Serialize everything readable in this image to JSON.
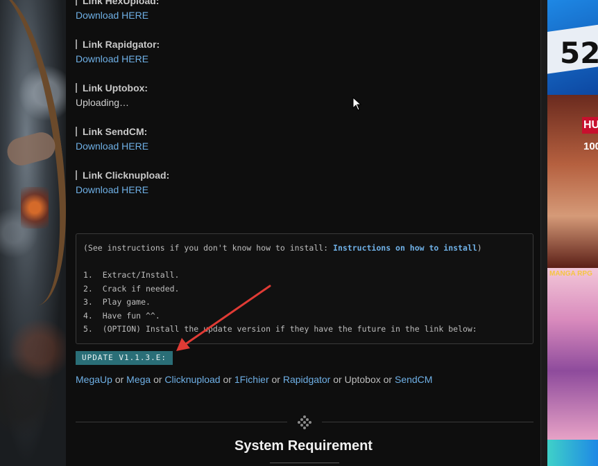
{
  "links": [
    {
      "label": "Link HexUpload:",
      "value": "Download HERE",
      "is_link": true
    },
    {
      "label": "Link Rapidgator:",
      "value": "Download HERE",
      "is_link": true
    },
    {
      "label": "Link Uptobox:",
      "value": "Uploading…",
      "is_link": false
    },
    {
      "label": "Link SendCM:",
      "value": "Download HERE",
      "is_link": true
    },
    {
      "label": "Link Clicknupload:",
      "value": "Download HERE",
      "is_link": true
    }
  ],
  "instructions": {
    "intro_prefix": "(See instructions if you don't know how to install: ",
    "intro_link": "Instructions on how to install",
    "intro_suffix": ")",
    "steps": [
      "1.  Extract/Install.",
      "2.  Crack if needed.",
      "3.  Play game.",
      "4.  Have fun ^^.",
      "5.  (OPTION) Install the update version if they have the future in the link below:"
    ]
  },
  "update_label": "UPDATE V1.1.3.E:",
  "mirrors": {
    "links": [
      "MegaUp",
      "Mega",
      "Clicknupload",
      "1Fichier",
      "Rapidgator"
    ],
    "plain": "Uptobox",
    "last": "SendCM",
    "separator": "or"
  },
  "section_title": "System Requirement",
  "ads": {
    "top_number": "52",
    "mid_text1": "HU",
    "mid_text2": "100",
    "bottom_logo": "MANGA RPG"
  },
  "colors": {
    "link": "#6fb0e6",
    "badge_bg": "#2a6e77",
    "arrow": "#e03b35",
    "background": "#0e0e0e"
  }
}
